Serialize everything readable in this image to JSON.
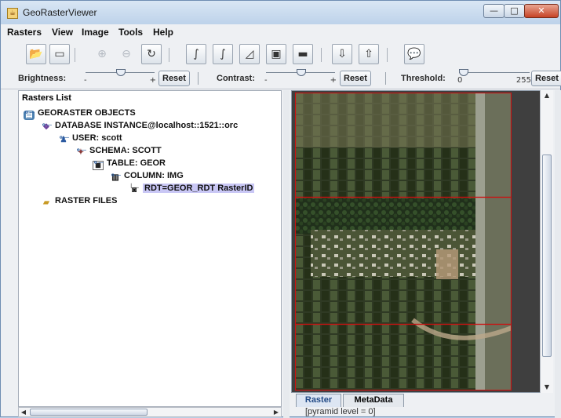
{
  "window": {
    "title": "GeoRasterViewer",
    "icon": "java-cup-icon"
  },
  "window_controls": {
    "minimize": "—",
    "maximize": "□",
    "close": "✕"
  },
  "menu": [
    "Rasters",
    "View",
    "Image",
    "Tools",
    "Help"
  ],
  "toolbar_icons": [
    "open-folder-icon",
    "open-file-icon",
    "zoom-in-icon",
    "zoom-out-icon",
    "pan-icon",
    "curve-icon",
    "curve-alt-icon",
    "histogram-icon",
    "image-view-icon",
    "image-alt-icon",
    "import-icon",
    "export-icon",
    "info-bubble-icon"
  ],
  "adjustments": {
    "brightness": {
      "label": "Brightness:",
      "min": "-",
      "max": "+",
      "reset": "Reset",
      "level": 0.5
    },
    "contrast": {
      "label": "Contrast:",
      "min": "-",
      "max": "+",
      "reset": "Reset",
      "level": 0.5
    },
    "threshold": {
      "label": "Threshold:",
      "min": "0",
      "max": "255",
      "reset": "Reset",
      "level": 0
    }
  },
  "tree": {
    "title": "Rasters List",
    "nodes": [
      {
        "label": "GEORASTER OBJECTS",
        "icon": "database-icon",
        "depth": 0
      },
      {
        "label": "DATABASE INSTANCE@localhost::1521::orc",
        "icon": "db-instance-icon",
        "depth": 1
      },
      {
        "label": "USER: scott",
        "icon": "user-icon",
        "depth": 2
      },
      {
        "label": "SCHEMA: SCOTT",
        "icon": "schema-icon",
        "depth": 3
      },
      {
        "label": "TABLE: GEOR",
        "icon": "table-icon",
        "depth": 4
      },
      {
        "label": "COLUMN: IMG",
        "icon": "column-icon",
        "depth": 5
      },
      {
        "label": "RDT=GEOR_RDT RasterID",
        "icon": "camera-icon",
        "depth": 6,
        "selected": true
      },
      {
        "label": "RASTER FILES",
        "icon": "folder-icon",
        "depth": 0
      }
    ]
  },
  "tabs": [
    {
      "label": "Raster",
      "active": true
    },
    {
      "label": "MetaData",
      "active": false
    }
  ],
  "status": "[pyramid level = 0]",
  "colors": {
    "accent": "#224a86",
    "selection": "#c9c7f5",
    "tile_border": "#cc1111"
  }
}
